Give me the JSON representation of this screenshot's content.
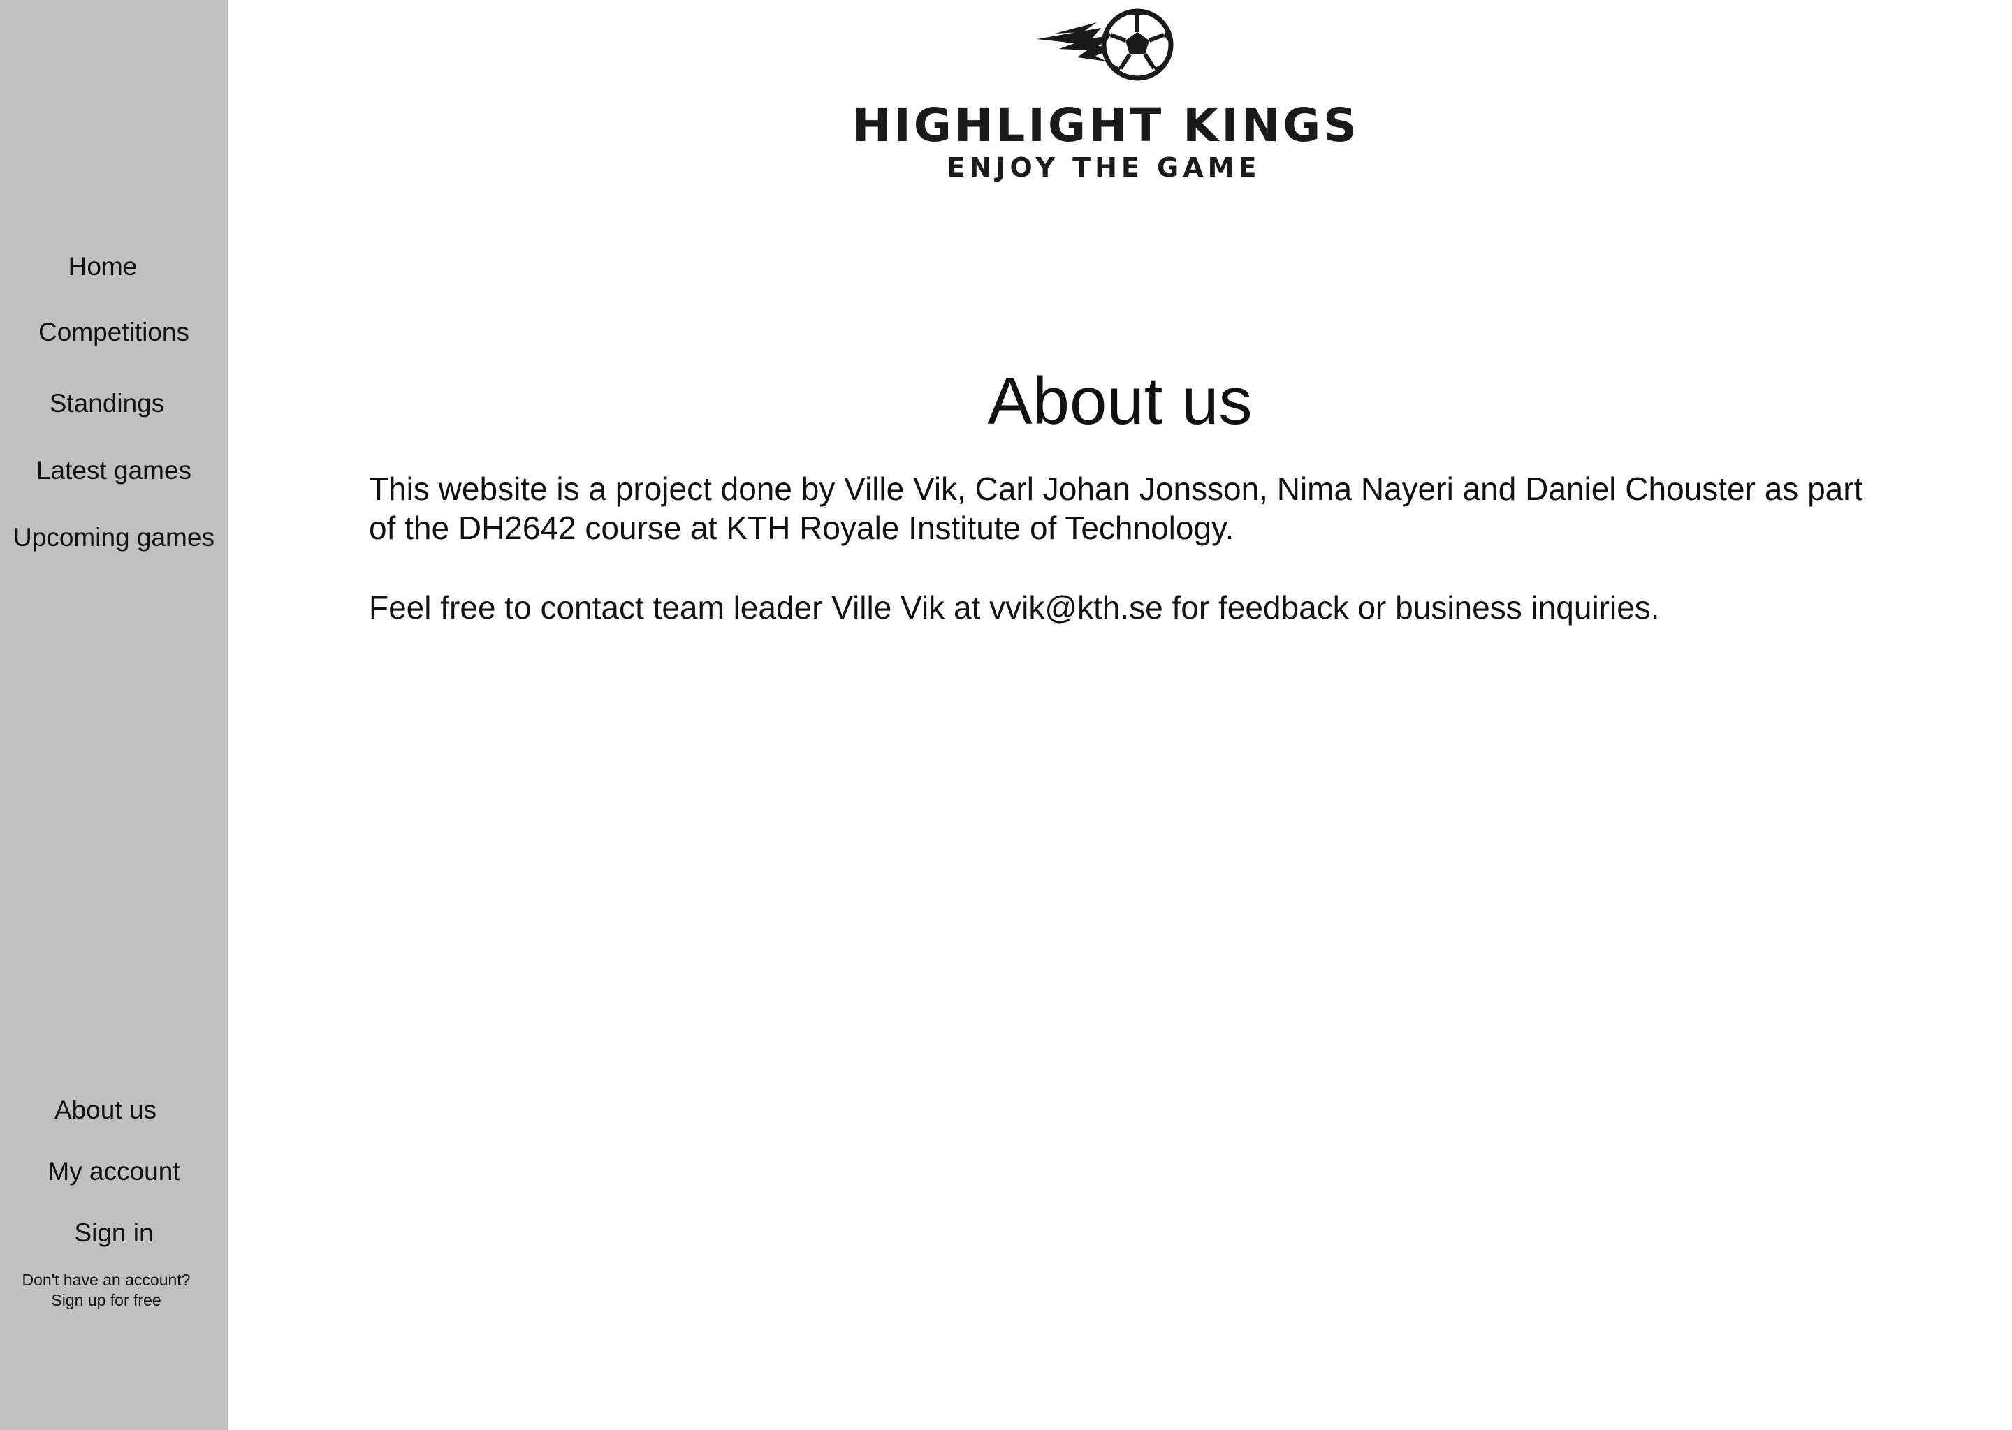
{
  "brand": {
    "title": "HIGHLIGHT KINGS",
    "tagline": "ENJOY THE GAME",
    "logo_icon": "soccer-ball-icon"
  },
  "sidebar": {
    "nav": [
      {
        "label": "Home"
      },
      {
        "label": "Competitions"
      },
      {
        "label": "Standings"
      },
      {
        "label": "Latest games"
      },
      {
        "label": "Upcoming games"
      }
    ],
    "bottom": [
      {
        "label": "About us"
      },
      {
        "label": "My account"
      },
      {
        "label": "Sign in"
      }
    ],
    "signup_line1": "Don't have an account?",
    "signup_line2": "Sign up for free"
  },
  "main": {
    "heading": "About us",
    "paragraph1": "This website is a project done by Ville Vik, Carl Johan Jonsson, Nima Nayeri and Daniel Chouster as part of the DH2642 course at KTH Royale Institute of Technology.",
    "paragraph2": "Feel free to contact team leader Ville Vik at vvik@kth.se for feedback or business inquiries."
  },
  "colors": {
    "sidebar_bg": "#c0c0c0",
    "page_bg": "#ffffff",
    "text": "#111111"
  }
}
